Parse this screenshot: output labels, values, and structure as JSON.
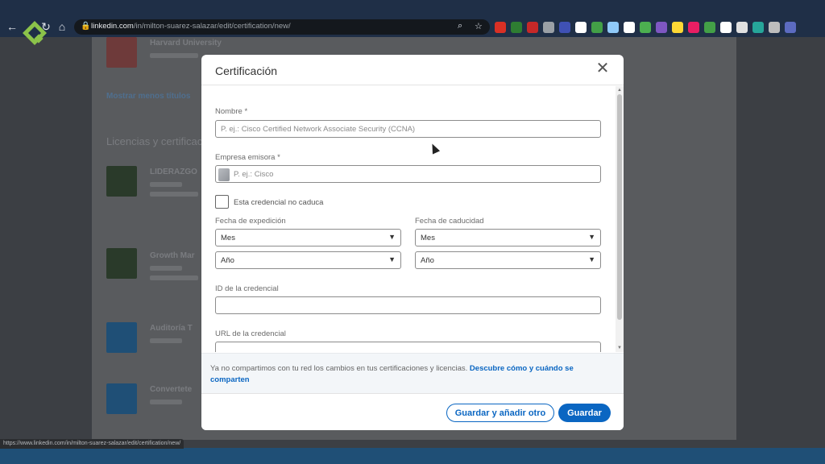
{
  "browser": {
    "url_host": "linkedin.com",
    "url_path": "/in/milton-suarez-salazar/edit/certification/new/",
    "status_url": "https://www.linkedin.com/in/milton-suarez-salazar/edit/certification/new/",
    "extension_colors": [
      "#d93025",
      "#2e7d32",
      "#c62828",
      "#9aa0a6",
      "#3f51b5",
      "#ffffff",
      "#43a047",
      "#90caf9",
      "#ffffff",
      "#4caf50",
      "#7e57c2",
      "#fdd835",
      "#e91e63",
      "#43a047",
      "#ffffff",
      "#e0e0e0",
      "#26a69a",
      "#bdbdbd",
      "#5c6bc0"
    ]
  },
  "background_page": {
    "partial_text_1": "Harvard University",
    "partial_text_2": "Mostrar menos títulos",
    "partial_text_3": "Licencias y certificaciones",
    "partial_text_4": "LIDERAZGO",
    "partial_text_5": "Growth Mar",
    "partial_text_6": "Auditoría T",
    "partial_text_7": "Convertete"
  },
  "modal": {
    "title": "Certificación",
    "close_glyph": "✕",
    "fields": {
      "name": {
        "label": "Nombre",
        "required_mark": "*",
        "placeholder": "P. ej.: Cisco Certified Network Associate Security (CCNA)",
        "value": ""
      },
      "issuer": {
        "label": "Empresa emisora",
        "required_mark": "*",
        "placeholder": "P. ej.: Cisco",
        "value": ""
      },
      "no_expiry": {
        "label": "Esta credencial no caduca",
        "checked": false
      },
      "issue_date": {
        "label": "Fecha de expedición",
        "month": "Mes",
        "year": "Año"
      },
      "expiry_date": {
        "label": "Fecha de caducidad",
        "month": "Mes",
        "year": "Año"
      },
      "credential_id": {
        "label": "ID de la credencial",
        "value": ""
      },
      "credential_url": {
        "label": "URL de la credencial",
        "value": ""
      }
    },
    "notice": {
      "text": "Ya no compartimos con tu red los cambios en tus certificaciones y licencias. ",
      "link": "Descubre cómo y cuándo se comparten"
    },
    "buttons": {
      "save_and_add": "Guardar y añadir otro",
      "save": "Guardar"
    }
  }
}
